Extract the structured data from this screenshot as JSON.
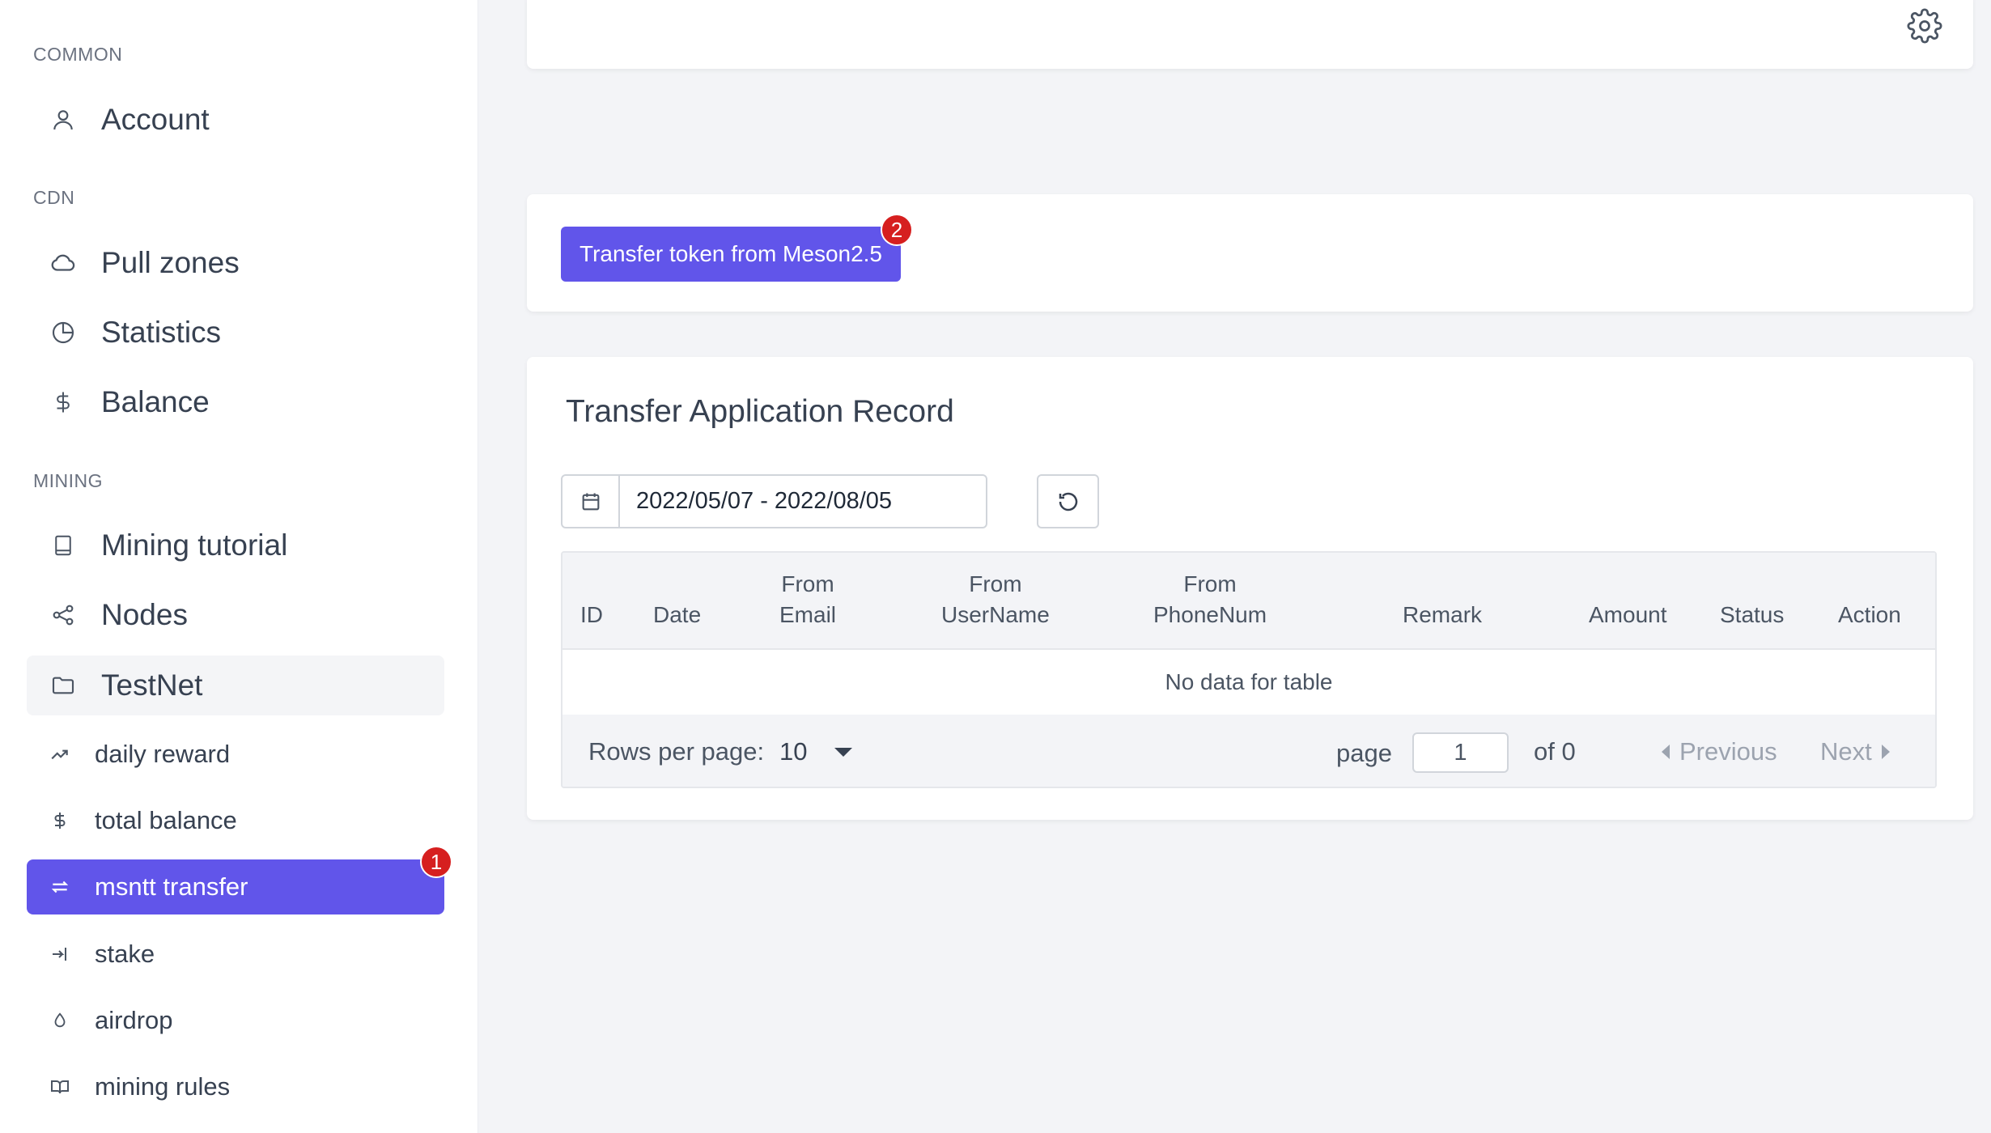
{
  "sidebar": {
    "sections": {
      "common": "COMMON",
      "cdn": "CDN",
      "mining": "MINING"
    },
    "items": {
      "account": "Account",
      "pull_zones": "Pull zones",
      "statistics": "Statistics",
      "balance": "Balance",
      "mining_tutorial": "Mining tutorial",
      "nodes": "Nodes",
      "testnet": "TestNet",
      "daily_reward": "daily reward",
      "total_balance": "total balance",
      "msntt_transfer": "msntt transfer",
      "stake": "stake",
      "airdrop": "airdrop",
      "mining_rules": "mining rules"
    },
    "active_item": "msntt transfer",
    "badge_number": "1"
  },
  "transfer_card": {
    "button_label": "Transfer token from Meson2.5",
    "badge_number": "2"
  },
  "record_card": {
    "title": "Transfer Application Record",
    "date_range": "2022/05/07 - 2022/08/05",
    "table": {
      "columns": {
        "id": "ID",
        "date": "Date",
        "from_email_1": "From",
        "from_email_2": "Email",
        "from_username_1": "From",
        "from_username_2": "UserName",
        "from_phone_1": "From",
        "from_phone_2": "PhoneNum",
        "remark": "Remark",
        "amount": "Amount",
        "status": "Status",
        "action": "Action"
      },
      "empty_text": "No data for table",
      "rows": []
    },
    "pagination": {
      "rows_per_page_label": "Rows per page:",
      "rows_per_page_value": "10",
      "page_label": "page",
      "current_page": "1",
      "of_total": "of 0",
      "previous": "Previous",
      "next": "Next"
    }
  },
  "colors": {
    "accent": "#6155ea",
    "badge": "#d61f1f",
    "background": "#f3f4f7"
  },
  "icons": {
    "header": "gear-icon",
    "date": "calendar-icon",
    "refresh": "refresh-icon"
  }
}
